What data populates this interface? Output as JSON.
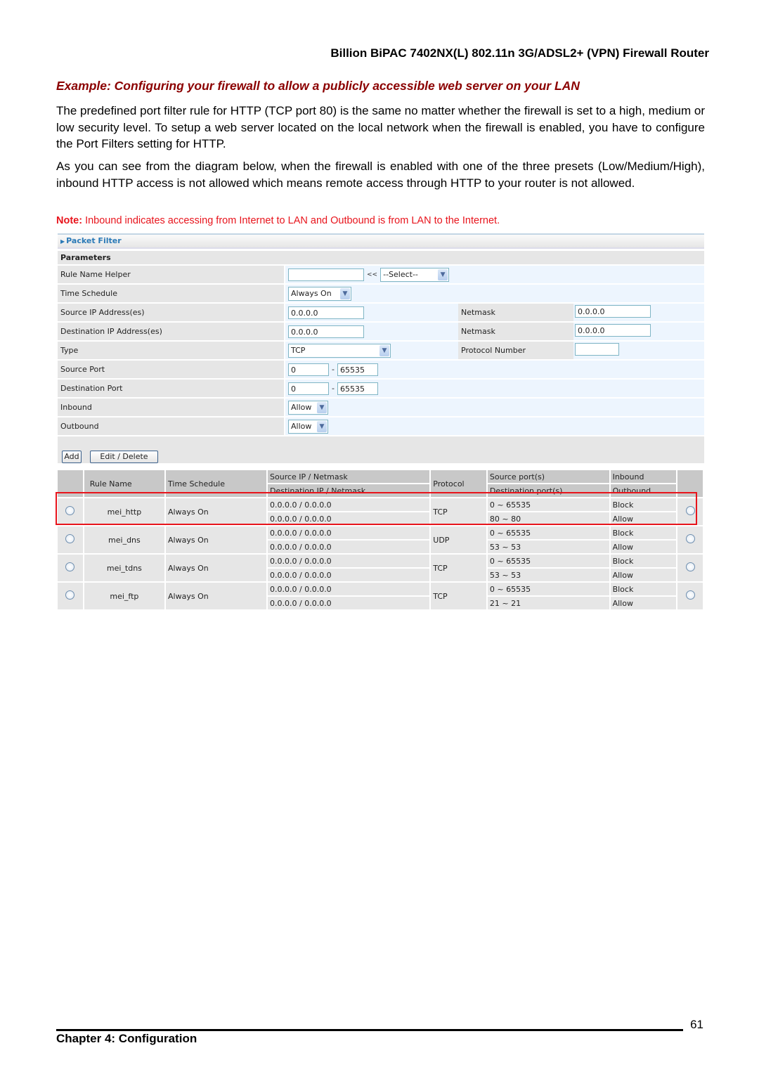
{
  "doc_header": "Billion BiPAC 7402NX(L) 802.11n 3G/ADSL2+ (VPN) Firewall Router",
  "example_heading": "Example: Configuring your firewall to allow a publicly accessible web server on your LAN",
  "paragraphs": [
    "The predefined port filter rule for HTTP (TCP port 80) is the same no matter whether the firewall is set to a high, medium or low security level. To setup a web server located on the local network when the firewall is enabled, you have to configure the Port Filters setting for HTTP.",
    "As you can see from the diagram below, when the firewall is enabled with one of the three presets (Low/Medium/High), inbound HTTP access is not allowed which means remote access through HTTP to your router is not allowed."
  ],
  "note": {
    "label": "Note:",
    "text": " Inbound indicates accessing from Internet to LAN and Outbound is from LAN to the Internet."
  },
  "screenshot": {
    "title": "Packet Filter",
    "section": "Parameters",
    "fields": {
      "rule_name": {
        "label": "Rule Name  Helper",
        "value": "",
        "helper_arrow": "<<",
        "helper_select": "--Select--"
      },
      "time_schedule": {
        "label": "Time Schedule",
        "value": "Always On"
      },
      "source_ip": {
        "label": "Source IP Address(es)",
        "value": "0.0.0.0",
        "netmask_label": "Netmask",
        "netmask": "0.0.0.0"
      },
      "dest_ip": {
        "label": "Destination IP Address(es)",
        "value": "0.0.0.0",
        "netmask_label": "Netmask",
        "netmask": "0.0.0.0"
      },
      "type": {
        "label": "Type",
        "value": "TCP",
        "protocol_label": "Protocol Number",
        "protocol_value": ""
      },
      "source_port": {
        "label": "Source Port",
        "from": "0",
        "sep": "-",
        "to": "65535"
      },
      "dest_port": {
        "label": "Destination Port",
        "from": "0",
        "sep": "-",
        "to": "65535"
      },
      "inbound": {
        "label": "Inbound",
        "value": "Allow"
      },
      "outbound": {
        "label": "Outbound",
        "value": "Allow"
      }
    },
    "buttons": {
      "add": "Add",
      "edit_delete": "Edit / Delete"
    },
    "table": {
      "headers": {
        "rule_name": "Rule Name",
        "time_schedule": "Time Schedule",
        "src_ip": "Source IP / Netmask",
        "dst_ip": "Destination IP / Netmask",
        "protocol": "Protocol",
        "src_port": "Source port(s)",
        "dst_port": "Destination port(s)",
        "inbound": "Inbound",
        "outbound": "Outbound"
      },
      "rows": [
        {
          "name": "mei_http",
          "schedule": "Always On",
          "src_ip": "0.0.0.0 / 0.0.0.0",
          "dst_ip": "0.0.0.0 / 0.0.0.0",
          "protocol": "TCP",
          "src_port": "0 ~ 65535",
          "dst_port": "80 ~ 80",
          "inbound": "Block",
          "outbound": "Allow",
          "highlighted": true
        },
        {
          "name": "mei_dns",
          "schedule": "Always On",
          "src_ip": "0.0.0.0 / 0.0.0.0",
          "dst_ip": "0.0.0.0 / 0.0.0.0",
          "protocol": "UDP",
          "src_port": "0 ~ 65535",
          "dst_port": "53 ~ 53",
          "inbound": "Block",
          "outbound": "Allow"
        },
        {
          "name": "mei_tdns",
          "schedule": "Always On",
          "src_ip": "0.0.0.0 / 0.0.0.0",
          "dst_ip": "0.0.0.0 / 0.0.0.0",
          "protocol": "TCP",
          "src_port": "0 ~ 65535",
          "dst_port": "53 ~ 53",
          "inbound": "Block",
          "outbound": "Allow"
        },
        {
          "name": "mei_ftp",
          "schedule": "Always On",
          "src_ip": "0.0.0.0 / 0.0.0.0",
          "dst_ip": "0.0.0.0 / 0.0.0.0",
          "protocol": "TCP",
          "src_port": "0 ~ 65535",
          "dst_port": "21 ~ 21",
          "inbound": "Block",
          "outbound": "Allow"
        }
      ]
    }
  },
  "footer": {
    "page_number": "61",
    "chapter": "Chapter 4: Configuration"
  },
  "colors": {
    "heading": "#8b0000",
    "note": "#e8141c",
    "highlight": "#e8141c",
    "link": "#2a79b6"
  }
}
